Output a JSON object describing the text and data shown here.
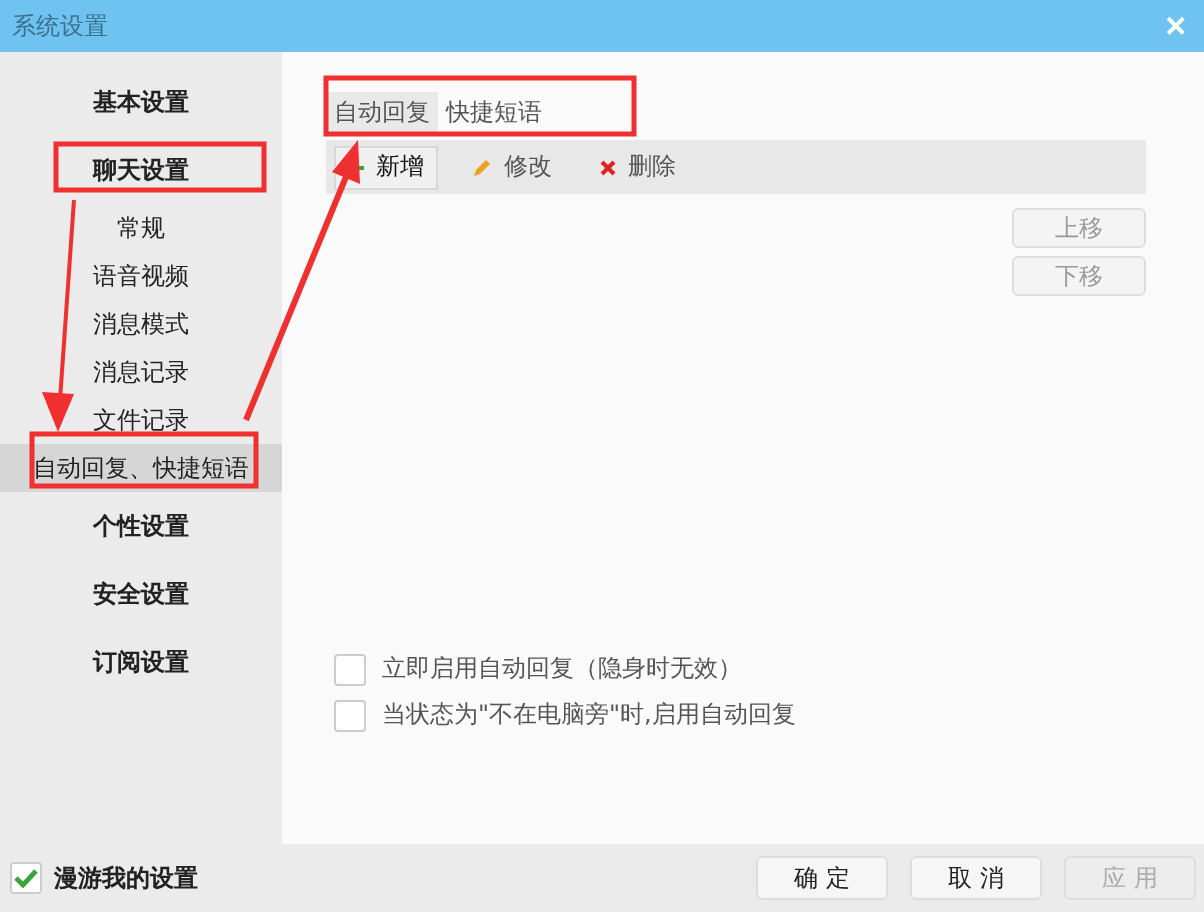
{
  "window": {
    "title": "系统设置",
    "close": "✕"
  },
  "sidebar": {
    "items": [
      {
        "label": "基本设置",
        "selected": false
      },
      {
        "label": "聊天设置",
        "selected": false,
        "children": [
          {
            "label": "常规",
            "selected": false
          },
          {
            "label": "语音视频",
            "selected": false
          },
          {
            "label": "消息模式",
            "selected": false
          },
          {
            "label": "消息记录",
            "selected": false
          },
          {
            "label": "文件记录",
            "selected": false
          },
          {
            "label": "自动回复、快捷短语",
            "selected": true
          }
        ]
      },
      {
        "label": "个性设置",
        "selected": false
      },
      {
        "label": "安全设置",
        "selected": false
      },
      {
        "label": "订阅设置",
        "selected": false
      }
    ]
  },
  "tabs": [
    {
      "label": "自动回复",
      "selected": true
    },
    {
      "label": "快捷短语",
      "selected": false
    }
  ],
  "toolbar": [
    {
      "kind": "add",
      "label": "新增"
    },
    {
      "kind": "edit",
      "label": "修改"
    },
    {
      "kind": "delete",
      "label": "删除"
    }
  ],
  "side_buttons": [
    {
      "label": "上移",
      "disabled": true
    },
    {
      "label": "下移",
      "disabled": true
    }
  ],
  "options": [
    {
      "label": "立即启用自动回复（隐身时无效）",
      "checked": false
    },
    {
      "label": "当状态为\"不在电脑旁\"时,启用自动回复",
      "checked": false
    }
  ],
  "footer": {
    "roam": {
      "label": "漫游我的设置",
      "checked": true
    },
    "buttons": [
      {
        "label": "确 定",
        "disabled": false
      },
      {
        "label": "取 消",
        "disabled": false
      },
      {
        "label": "应 用",
        "disabled": true
      }
    ]
  }
}
